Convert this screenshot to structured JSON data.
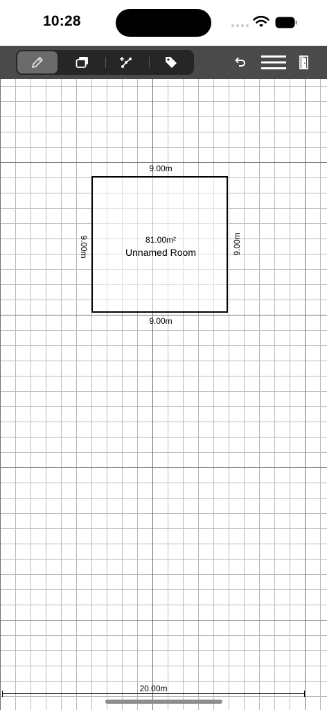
{
  "status_bar": {
    "time": "10:28"
  },
  "toolbar": {
    "tools": [
      {
        "name": "draw",
        "icon": "pencil-icon",
        "selected": true
      },
      {
        "name": "rooms",
        "icon": "overlapping-squares-icon",
        "selected": false
      },
      {
        "name": "points",
        "icon": "add-vertex-icon",
        "selected": false
      },
      {
        "name": "labels",
        "icon": "tag-icon",
        "selected": false
      }
    ],
    "undo_icon": "undo-arrow-icon",
    "menu_icon": "hamburger-menu-icon",
    "exit_icon": "door-exit-icon"
  },
  "room": {
    "area": "81.00m²",
    "name": "Unnamed Room",
    "width_label_top": "9.00m",
    "width_label_bottom": "9.00m",
    "height_label_left": "9.00m",
    "height_label_right": "9.00m"
  },
  "scale": {
    "label": "20.00m"
  },
  "colors": {
    "toolbar_bg": "#4a4a4a",
    "segment_bg": "#262626",
    "segment_selected": "#6b6b6b",
    "grid_major": "#6f6f6f",
    "grid_minor": "#b9b9b9"
  }
}
